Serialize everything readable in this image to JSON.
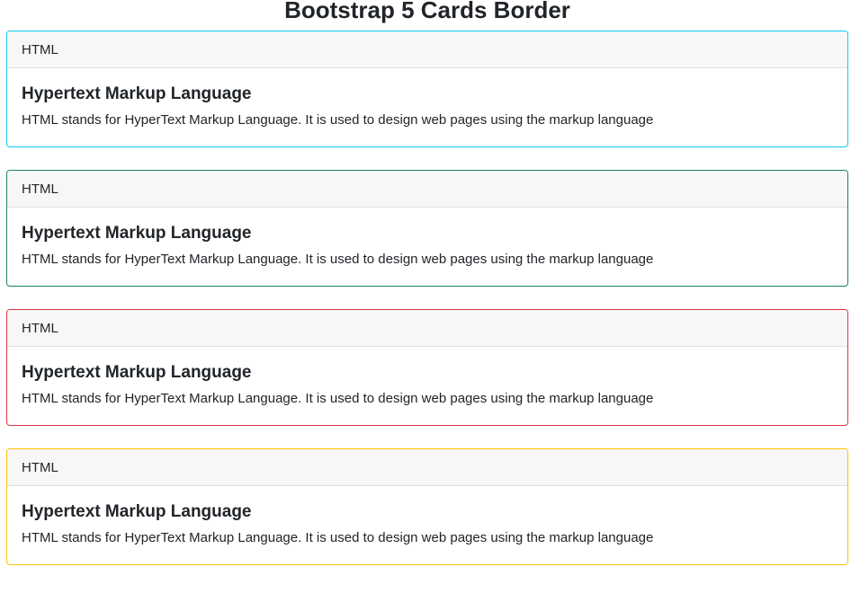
{
  "page": {
    "title": "Bootstrap 5 Cards Border"
  },
  "cards": [
    {
      "border_color": "#0dcaf0",
      "header": "HTML",
      "title": "Hypertext Markup Language",
      "text": "HTML stands for HyperText Markup Language. It is used to design web pages using the markup language"
    },
    {
      "border_color": "#198754",
      "header": "HTML",
      "title": "Hypertext Markup Language",
      "text": "HTML stands for HyperText Markup Language. It is used to design web pages using the markup language"
    },
    {
      "border_color": "#dc3545",
      "header": "HTML",
      "title": "Hypertext Markup Language",
      "text": "HTML stands for HyperText Markup Language. It is used to design web pages using the markup language"
    },
    {
      "border_color": "#ffc107",
      "header": "HTML",
      "title": "Hypertext Markup Language",
      "text": "HTML stands for HyperText Markup Language. It is used to design web pages using the markup language"
    }
  ]
}
